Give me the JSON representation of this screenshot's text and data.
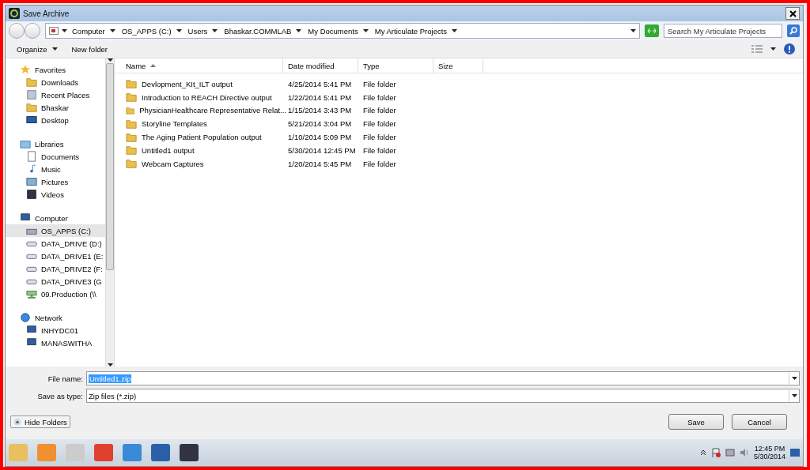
{
  "window": {
    "title": "Save Archive"
  },
  "address": {
    "crumbs": [
      "Computer",
      "OS_APPS (C:)",
      "Users",
      "Bhaskar.COMMLAB",
      "My Documents",
      "My Articulate Projects"
    ]
  },
  "search": {
    "placeholder": "Search My Articulate Projects"
  },
  "toolbar": {
    "buttons": [
      {
        "label": "Organize",
        "kind": "menu"
      },
      {
        "label": "New folder",
        "kind": "plain"
      }
    ]
  },
  "sidebar": {
    "groups": [
      {
        "label": "Favorites",
        "kind": "star",
        "items": [
          {
            "label": "Downloads",
            "kind": "folder",
            "selected": false
          },
          {
            "label": "Recent Places",
            "kind": "recent",
            "selected": false
          },
          {
            "label": "Bhaskar",
            "kind": "folder",
            "selected": false
          },
          {
            "label": "Desktop",
            "kind": "desktop",
            "selected": false
          }
        ]
      },
      {
        "label": "Libraries",
        "kind": "library",
        "items": [
          {
            "label": "Documents",
            "kind": "document",
            "selected": false
          },
          {
            "label": "Music",
            "kind": "music",
            "selected": false
          },
          {
            "label": "Pictures",
            "kind": "picture",
            "selected": false
          },
          {
            "label": "Videos",
            "kind": "video",
            "selected": false
          }
        ]
      },
      {
        "label": "Computer",
        "kind": "computer",
        "items": [
          {
            "label": "OS_APPS (C:)",
            "kind": "windrive",
            "selected": true
          },
          {
            "label": "DATA_DRIVE (D:)",
            "kind": "drive",
            "selected": false
          },
          {
            "label": "DATA_DRIVE1 (E:",
            "kind": "drive",
            "selected": false
          },
          {
            "label": "DATA_DRIVE2 (F:",
            "kind": "drive",
            "selected": false
          },
          {
            "label": "DATA_DRIVE3 (G",
            "kind": "drive",
            "selected": false
          },
          {
            "label": "09.Production (\\\\",
            "kind": "netdrive",
            "selected": false
          }
        ]
      },
      {
        "label": "Network",
        "kind": "network",
        "items": [
          {
            "label": "INHYDC01",
            "kind": "computer",
            "selected": false
          },
          {
            "label": "MANASWITHA",
            "kind": "computer",
            "selected": false
          }
        ]
      }
    ]
  },
  "table": {
    "columns": [
      {
        "label": "Name",
        "sorted": true
      },
      {
        "label": "Date modified",
        "sorted": false
      },
      {
        "label": "Type",
        "sorted": false
      },
      {
        "label": "Size",
        "sorted": false
      }
    ],
    "rows": [
      {
        "name": "Devlopment_KIt_ILT output",
        "date": "4/25/2014 5:41 PM",
        "type": "File folder"
      },
      {
        "name": "Introduction to REACH Directive output",
        "date": "1/22/2014 5:41 PM",
        "type": "File folder"
      },
      {
        "name": "PhysicianHealthcare Representative Relat...",
        "date": "1/15/2014 3:43 PM",
        "type": "File folder"
      },
      {
        "name": "Storyline Templates",
        "date": "5/21/2014 3:04 PM",
        "type": "File folder"
      },
      {
        "name": "The Aging Patient Population output",
        "date": "1/10/2014 5:09 PM",
        "type": "File folder"
      },
      {
        "name": "Untitled1 output",
        "date": "5/30/2014 12:45 PM",
        "type": "File folder"
      },
      {
        "name": "Webcam Captures",
        "date": "1/20/2014 5:45 PM",
        "type": "File folder"
      }
    ]
  },
  "file_name": {
    "label": "File name:",
    "value": "Untitled1.zip"
  },
  "save_as_type": {
    "label": "Save as type:",
    "value": "Zip files (*.zip)"
  },
  "hide_folders": "Hide Folders",
  "buttons": [
    "Save",
    "Cancel"
  ],
  "clock": {
    "time": "12:45 PM",
    "date": "5/30/2014"
  }
}
